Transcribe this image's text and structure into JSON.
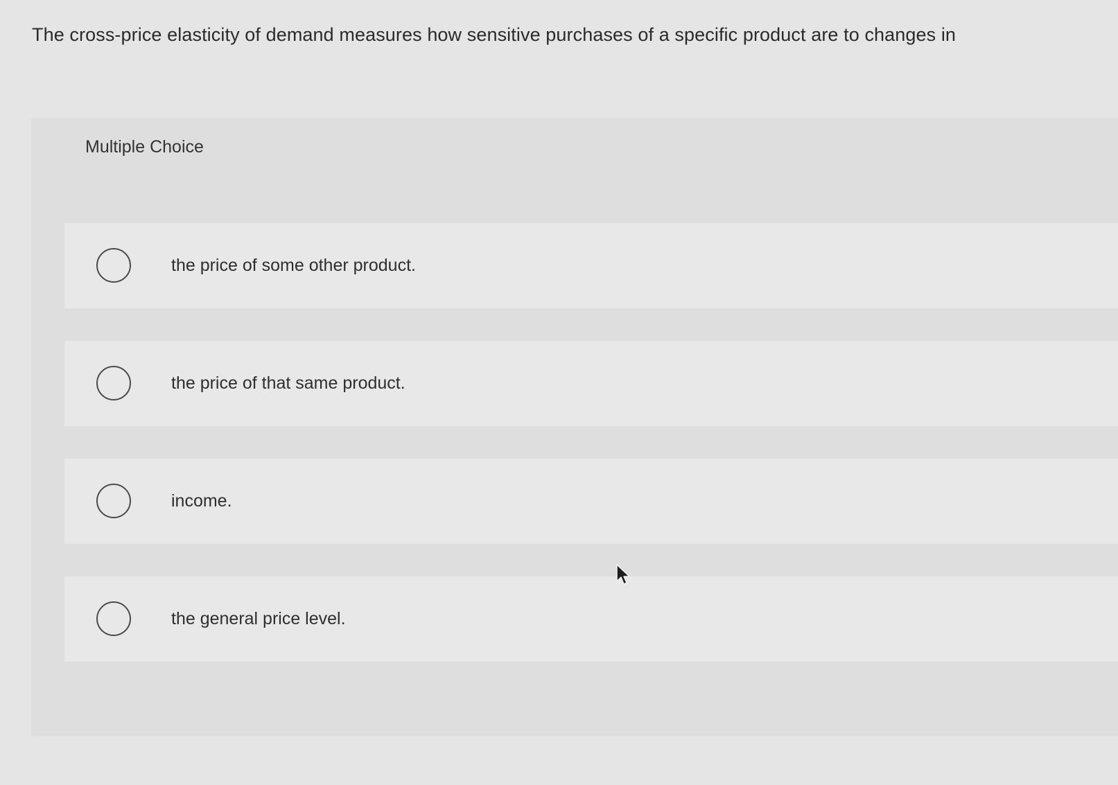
{
  "question": {
    "text": "The cross-price elasticity of demand measures how sensitive purchases of a specific product are to changes in"
  },
  "multiple_choice": {
    "label": "Multiple Choice",
    "options": [
      {
        "text": "the price of some other product.",
        "selected": false
      },
      {
        "text": "the price of that same product.",
        "selected": false
      },
      {
        "text": "income.",
        "selected": false
      },
      {
        "text": "the general price level.",
        "selected": false
      }
    ]
  },
  "icons": {
    "radio": "radio-button-icon",
    "cursor": "mouse-pointer-icon"
  },
  "colors": {
    "page_background": "#e5e5e5",
    "panel_background": "#dedede",
    "option_background": "#e8e8e8",
    "radio_border": "#4a4a4a",
    "text": "#2b2b2b"
  }
}
